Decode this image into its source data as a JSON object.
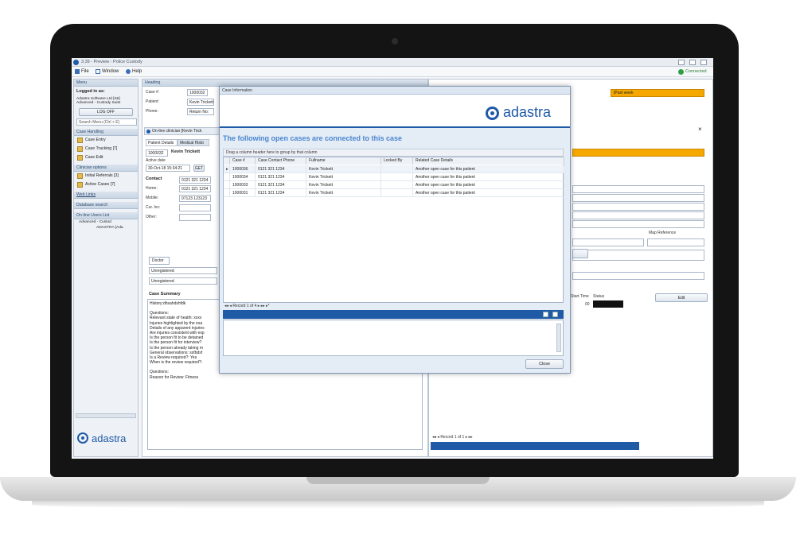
{
  "app": {
    "title": "3.39 - Preview - Police Custody",
    "status": "Connected"
  },
  "menu": {
    "items": [
      "File",
      "Window",
      "Help"
    ]
  },
  "sidebar": {
    "title": "Menu",
    "logged_in_label": "Logged in as:",
    "user_line1": "Adastra Software Ltd [S6]",
    "user_line2": "Advanced - Custody Suite",
    "logoff_label": "LOG OFF",
    "search_placeholder": "Search Menu (Ctrl + E)",
    "sections": [
      {
        "title": "Case Handling",
        "items": [
          "Case Entry",
          "Case Tracking [7]",
          "Case Edit"
        ]
      },
      {
        "title": "Clinician options",
        "items": [
          "Initial Referrals [3]",
          "Active Cases [7]"
        ]
      },
      {
        "title": "Web Links",
        "items": []
      },
      {
        "title": "Database search",
        "items": []
      },
      {
        "title": "On-line Users List",
        "items": [
          "Advanced - Custod",
          "ADASTRA [Ada"
        ]
      }
    ],
    "logo_text": "adastra"
  },
  "heading": {
    "title": "Heading",
    "case_label": "Case #:",
    "case_value": "1000032",
    "patient_label": "Patient:",
    "patient_value": "Kevin Trickett",
    "phone_label": "Phone:",
    "phone_value": "Return No:"
  },
  "clinician_tab": "On-line clinician [Kevin Trick",
  "patient_tabs": [
    "Patient Details",
    "Medical Histo"
  ],
  "patient": {
    "case_no": "1000032",
    "name": "Kevin Trickett",
    "active_date_label": "Active date",
    "active_date": "30-Oct-18 15:34:21",
    "get_btn": "GET",
    "contact_label": "Contact",
    "phone": "0121 321 1234",
    "home_label": "Home:",
    "home": "0121 321 1234",
    "mobile_label": "Mobile:",
    "mobile": "07123 123123",
    "curloc_label": "Cur. loc:",
    "other_label": "Other:"
  },
  "doctor": {
    "tab": "Doctor",
    "reg1": "Unregistered",
    "reg2": "Unregistered"
  },
  "case_summary": {
    "title": "Case Summary",
    "lines": [
      "History:dhsahdshfdk",
      "",
      "Questions:",
      "Relevant state of health: xxxx",
      "Injuries highlighted by the exa",
      "Details of any apparent injuries",
      "Are injuries consistent with exp",
      "Is the person fit to be detained",
      "Is the person fit for interview?",
      "Is the person already taking m",
      "General observations: ssfbdsf",
      "Is a Review required?: Yes",
      "When is the review required?:",
      "",
      "Questions:",
      "Reason for Review: Fitness"
    ]
  },
  "right": {
    "status_banner": "[Past week",
    "map_ref_label": "Map Reference",
    "edit_btn": "Edit",
    "col_start_time": "Start Time",
    "col_status": "Status",
    "row_value": "00",
    "pager": "Record 1 of 1"
  },
  "dialog": {
    "window_title": "Case Information",
    "logo_text": "adastra",
    "heading": "The following open cases are connected to this case",
    "group_hint": "Drag a column header here to group by that column",
    "columns": [
      "Case #",
      "Case Contact Phone",
      "Fullname",
      "Locked By",
      "Related Case Details"
    ],
    "rows": [
      [
        "1000036",
        "0121 321 1234",
        "Kevin Trickett",
        "",
        "Another open case for this patient"
      ],
      [
        "1000034",
        "0121 321 1234",
        "Kevin Trickett",
        "",
        "Another open case for this patient"
      ],
      [
        "1000033",
        "0121 321 1234",
        "Kevin Trickett",
        "",
        "Another open case for this patient"
      ],
      [
        "1000031",
        "0121 321 1234",
        "Kevin Trickett",
        "",
        "Another open case for this patient"
      ]
    ],
    "pager": "Record 1 of 4",
    "close_label": "Close"
  },
  "colors": {
    "accent": "#1f5aa6",
    "banner": "#f5a800",
    "heading_blue": "#4a86d0"
  }
}
